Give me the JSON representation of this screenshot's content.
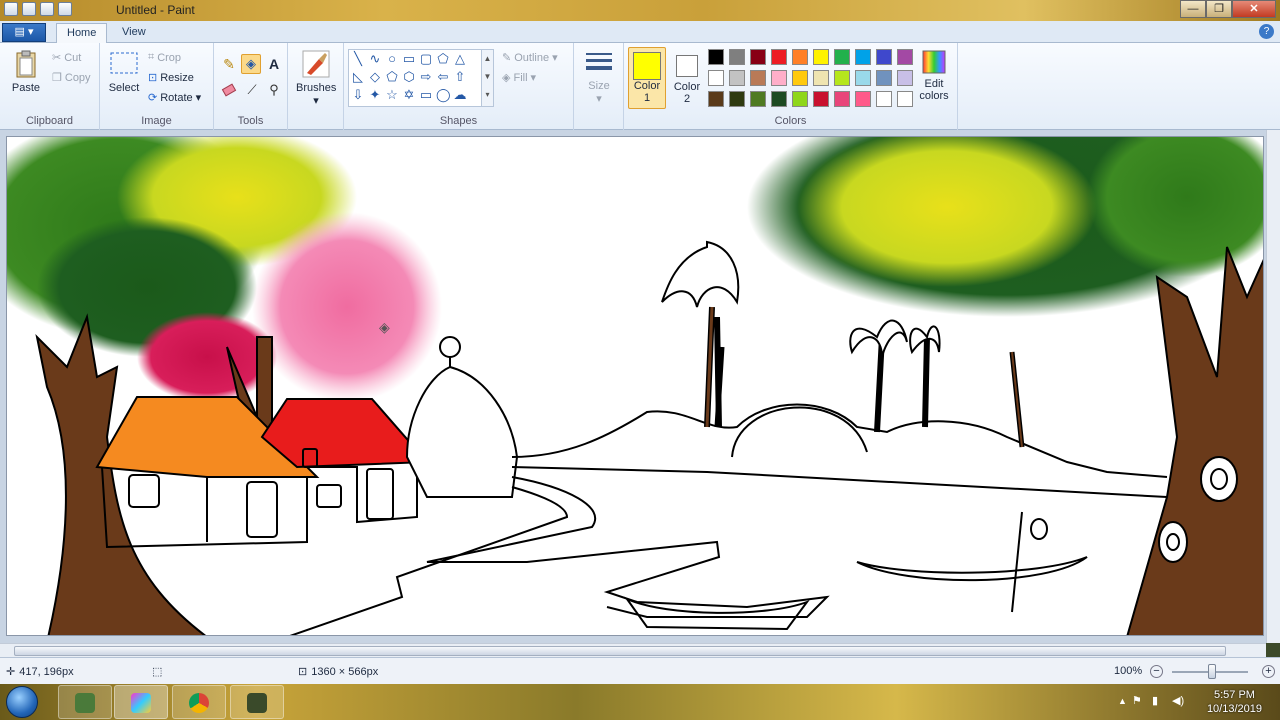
{
  "window": {
    "title": "Untitled - Paint",
    "minimize_glyph": "—",
    "maximize_glyph": "❐",
    "close_glyph": "✕"
  },
  "tabs": {
    "app_menu_label": "▤ ▾",
    "home": "Home",
    "view": "View",
    "help_glyph": "?"
  },
  "ribbon": {
    "clipboard": {
      "label": "Clipboard",
      "paste": "Paste",
      "cut": "Cut",
      "copy": "Copy"
    },
    "image": {
      "label": "Image",
      "select": "Select",
      "crop": "Crop",
      "resize": "Resize",
      "rotate": "Rotate"
    },
    "tools": {
      "label": "Tools",
      "text_glyph": "A"
    },
    "brushes": {
      "label": "Brushes"
    },
    "shapes": {
      "label": "Shapes",
      "outline": "Outline",
      "fill": "Fill"
    },
    "size": {
      "label": "Size"
    },
    "colors": {
      "label": "Colors",
      "color1": "Color",
      "color1_num": "1",
      "color2": "Color",
      "color2_num": "2",
      "edit": "Edit",
      "edit2": "colors",
      "color1_value": "#ffff00",
      "color2_value": "#ffffff",
      "palette_row1": [
        "#000000",
        "#7f7f7f",
        "#880015",
        "#ed1c24",
        "#ff7f27",
        "#fff200",
        "#22b14c",
        "#00a2e8",
        "#3f48cc",
        "#a349a4"
      ],
      "palette_row2": [
        "#ffffff",
        "#c3c3c3",
        "#b97a57",
        "#ffaec9",
        "#ffc90e",
        "#efe4b0",
        "#b5e61d",
        "#99d9ea",
        "#7092be",
        "#c8bfe7"
      ],
      "palette_row3": [
        "#5a3a1a",
        "#2f3a10",
        "#4f7a22",
        "#1d4a22",
        "#8fd61a",
        "#c8102e",
        "#e8457a",
        "#ff5a8a",
        "#ffffff",
        "#ffffff"
      ]
    }
  },
  "status": {
    "cursor_pos": "417, 196px",
    "canvas_size": "1360 × 566px",
    "zoom": "100%"
  },
  "taskbar": {
    "time": "5:57 PM",
    "date": "10/13/2019"
  }
}
